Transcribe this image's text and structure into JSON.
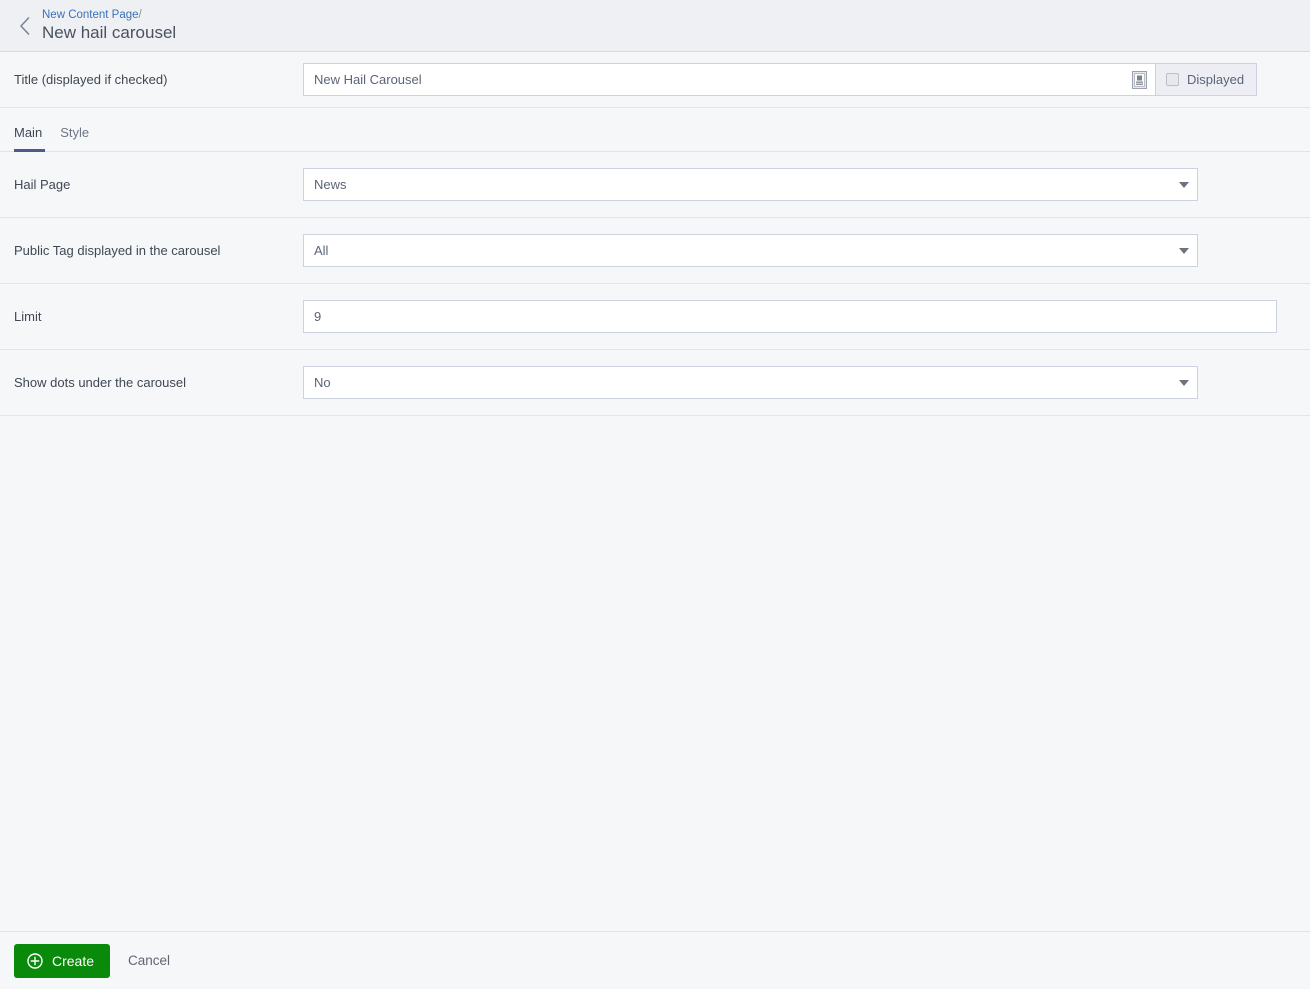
{
  "header": {
    "back_icon": "chevron-left-icon",
    "breadcrumb_parent": "New Content Page",
    "breadcrumb_separator": "/",
    "page_title": "New hail carousel"
  },
  "title_row": {
    "label": "Title (displayed if checked)",
    "value": "New Hail Carousel",
    "placeholder": "",
    "lang_icon": "translation-icon",
    "displayed_label": "Displayed",
    "displayed_checked": false
  },
  "tabs": [
    {
      "label": "Main",
      "active": true
    },
    {
      "label": "Style",
      "active": false
    }
  ],
  "fields": [
    {
      "label": "Hail Page",
      "type": "select",
      "value": "News",
      "options": [
        "News"
      ]
    },
    {
      "label": "Public Tag displayed in the carousel",
      "type": "select",
      "value": "All",
      "options": [
        "All"
      ]
    },
    {
      "label": "Limit",
      "type": "text",
      "value": "9",
      "placeholder": ""
    },
    {
      "label": "Show dots under the carousel",
      "type": "select",
      "value": "No",
      "options": [
        "No"
      ]
    }
  ],
  "footer": {
    "create_label": "Create",
    "create_icon": "circle-plus-icon",
    "cancel_label": "Cancel"
  },
  "colors": {
    "accent_link": "#3b73b9",
    "tab_active_underline": "#4b5c86",
    "create_button": "#0a8a0a",
    "header_bg": "#eff0f4",
    "body_bg": "#f6f7f9"
  }
}
